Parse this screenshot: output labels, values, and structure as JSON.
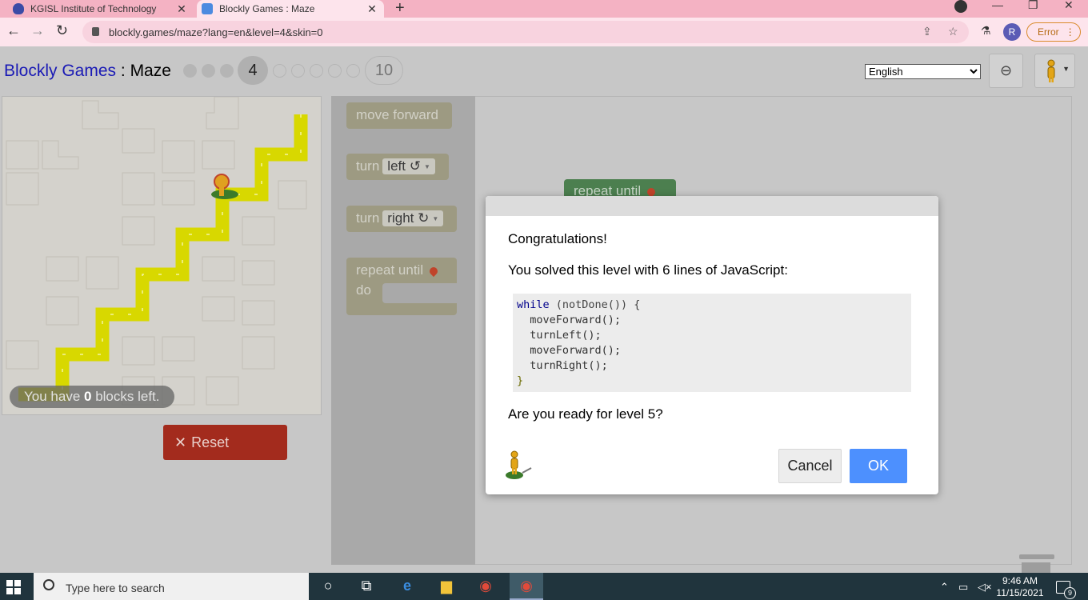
{
  "browser": {
    "tabs": [
      {
        "title": "KGISL Institute of Technology",
        "active": false
      },
      {
        "title": "Blockly Games : Maze",
        "active": true
      }
    ],
    "url": "blockly.games/maze?lang=en&level=4&skin=0",
    "profile_initial": "R",
    "error_label": "Error"
  },
  "app": {
    "title_games": "Blockly Games",
    "title_separator": " : ",
    "title_game": "Maze",
    "levels": {
      "current": "4",
      "last": "10",
      "completed": 3,
      "remaining_dots": 5
    },
    "language": {
      "selected": "English",
      "options": [
        "English"
      ]
    }
  },
  "maze": {
    "blocks_left_prefix": "You have ",
    "blocks_left_count": "0",
    "blocks_left_suffix": " blocks left.",
    "reset_label": "Reset"
  },
  "toolbox": {
    "move_forward": "move forward",
    "turn_left_prefix": "turn",
    "turn_left_value": "left ↺",
    "turn_right_prefix": "turn",
    "turn_right_value": "right ↻",
    "repeat_until": "repeat until",
    "do_label": "do"
  },
  "workspace": {
    "block_label": "repeat until"
  },
  "dialog": {
    "congrats": "Congratulations!",
    "solved_text": "You solved this level with 6 lines of JavaScript:",
    "code": {
      "l1_kw": "while",
      "l1_rest": " (notDone()) {",
      "l2": "  moveForward();",
      "l3": "  turnLeft();",
      "l4": "  moveForward();",
      "l5": "  turnRight();",
      "l6": "}"
    },
    "ready_text": "Are you ready for level 5?",
    "cancel_label": "Cancel",
    "ok_label": "OK"
  },
  "taskbar": {
    "search_placeholder": "Type here to search",
    "time": "9:46 AM",
    "date": "11/15/2021",
    "notification_count": "9"
  },
  "colors": {
    "accent_blue": "#4d90fe",
    "reset_red": "#a32b1d",
    "path_yellow": "#d8d800",
    "block_green": "#4c7f4f"
  }
}
